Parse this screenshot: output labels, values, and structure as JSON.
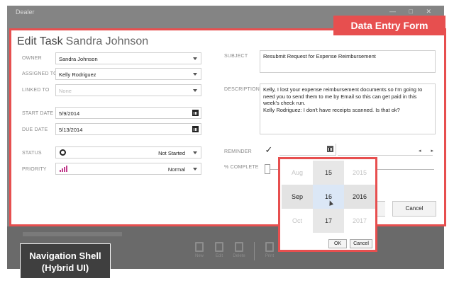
{
  "shell": {
    "title": "Dealer",
    "window_controls": "— □ ✕",
    "toolbar": [
      {
        "label": "New",
        "icon": "document-icon"
      },
      {
        "label": "Edit",
        "icon": "pencil-icon"
      },
      {
        "label": "Delete",
        "icon": "trash-icon"
      },
      {
        "label": "Print",
        "icon": "printer-icon"
      }
    ]
  },
  "form": {
    "title": "Edit Task",
    "title_name": "Sandra Johnson",
    "owner": {
      "label": "OWNER",
      "value": "Sandra Johnson"
    },
    "assigned_to": {
      "label": "ASSIGNED TO",
      "value": "Kelly Rodriguez"
    },
    "linked_to": {
      "label": "LINKED TO",
      "value": "None"
    },
    "start_date": {
      "label": "START DATE",
      "value": "5/9/2014"
    },
    "due_date": {
      "label": "DUE DATE",
      "value": "5/13/2014"
    },
    "status": {
      "label": "STATUS",
      "value": "Not Started"
    },
    "priority": {
      "label": "PRIORITY",
      "value": "Normal"
    },
    "subject": {
      "label": "SUBJECT",
      "value": "Resubmit Request for Expense Reimbursement"
    },
    "description": {
      "label": "DESCRIPTION",
      "lines": [
        "Kelly, I lost your expense reimbursement documents so I'm going to",
        "need you to send them to me by Email so this can get paid in this",
        "week's check run.",
        "Kelly Rodriguez: I don't have receipts scanned. Is that ok?"
      ]
    },
    "reminder": {
      "label": "REMINDER",
      "checkmark": "✓",
      "arrows": "◂ ▸"
    },
    "percent_complete": {
      "label": "% COMPLETE"
    },
    "buttons": {
      "cancel": "Cancel"
    }
  },
  "date_picker": {
    "months": [
      "Aug",
      "Sep",
      "Oct"
    ],
    "days": [
      "15",
      "16",
      "17"
    ],
    "years": [
      "2015",
      "2016",
      "2017"
    ],
    "ok": "OK",
    "cancel": "Cancel"
  },
  "callouts": {
    "data_entry": "Data Entry Form",
    "nav_line1": "Navigation Shell",
    "nav_line2": "(Hybrid UI)"
  },
  "colors": {
    "accent": "#e74f4f",
    "shell": "#848484",
    "selected": "#dbe7f6"
  }
}
